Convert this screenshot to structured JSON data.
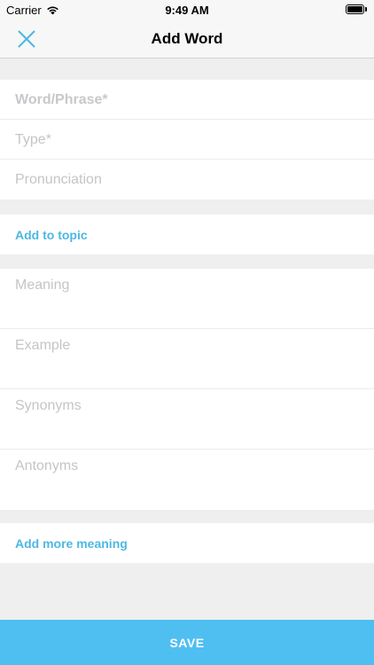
{
  "status_bar": {
    "carrier": "Carrier",
    "time": "9:49 AM",
    "icons": [
      "wifi-icon",
      "battery-icon"
    ]
  },
  "nav": {
    "title": "Add Word",
    "close_icon": "close-icon"
  },
  "word_section": {
    "word_placeholder": "Word/Phrase*",
    "type_placeholder": "Type*",
    "pronunciation_placeholder": "Pronunciation"
  },
  "topic": {
    "label": "Add to topic"
  },
  "meaning_section": {
    "meaning_placeholder": "Meaning",
    "example_placeholder": "Example",
    "synonyms_placeholder": "Synonyms",
    "antonyms_placeholder": "Antonyms"
  },
  "add_more": {
    "label": "Add more meaning"
  },
  "save": {
    "label": "SAVE"
  },
  "colors": {
    "accent": "#4cb8e4",
    "save_button": "#4fbff2",
    "background": "#efeff0",
    "placeholder": "#c5c5c9"
  }
}
